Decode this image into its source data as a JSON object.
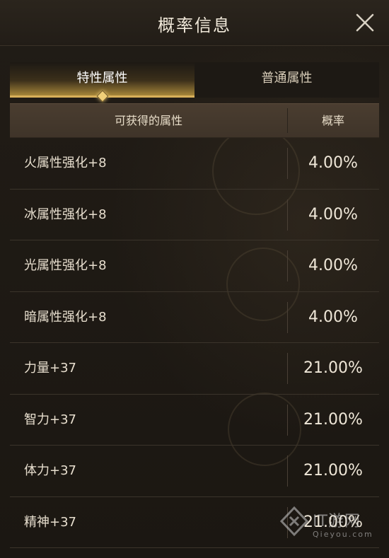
{
  "dialog": {
    "title": "概率信息"
  },
  "tabs": [
    {
      "label": "特性属性",
      "active": true
    },
    {
      "label": "普通属性",
      "active": false
    }
  ],
  "table": {
    "headers": {
      "attribute": "可获得的属性",
      "rate": "概率"
    },
    "rows": [
      {
        "attribute": "火属性强化+8",
        "rate": "4.00%"
      },
      {
        "attribute": "冰属性强化+8",
        "rate": "4.00%"
      },
      {
        "attribute": "光属性强化+8",
        "rate": "4.00%"
      },
      {
        "attribute": "暗属性强化+8",
        "rate": "4.00%"
      },
      {
        "attribute": "力量+37",
        "rate": "21.00%"
      },
      {
        "attribute": "智力+37",
        "rate": "21.00%"
      },
      {
        "attribute": "体力+37",
        "rate": "21.00%"
      },
      {
        "attribute": "精神+37",
        "rate": "21.00%"
      }
    ]
  },
  "watermark": {
    "brand": "IT游网",
    "url": "Qieyou.com"
  },
  "colors": {
    "accent_gold": "#d8b05a",
    "background": "#1b1712",
    "header_row": "#4a3d30"
  }
}
